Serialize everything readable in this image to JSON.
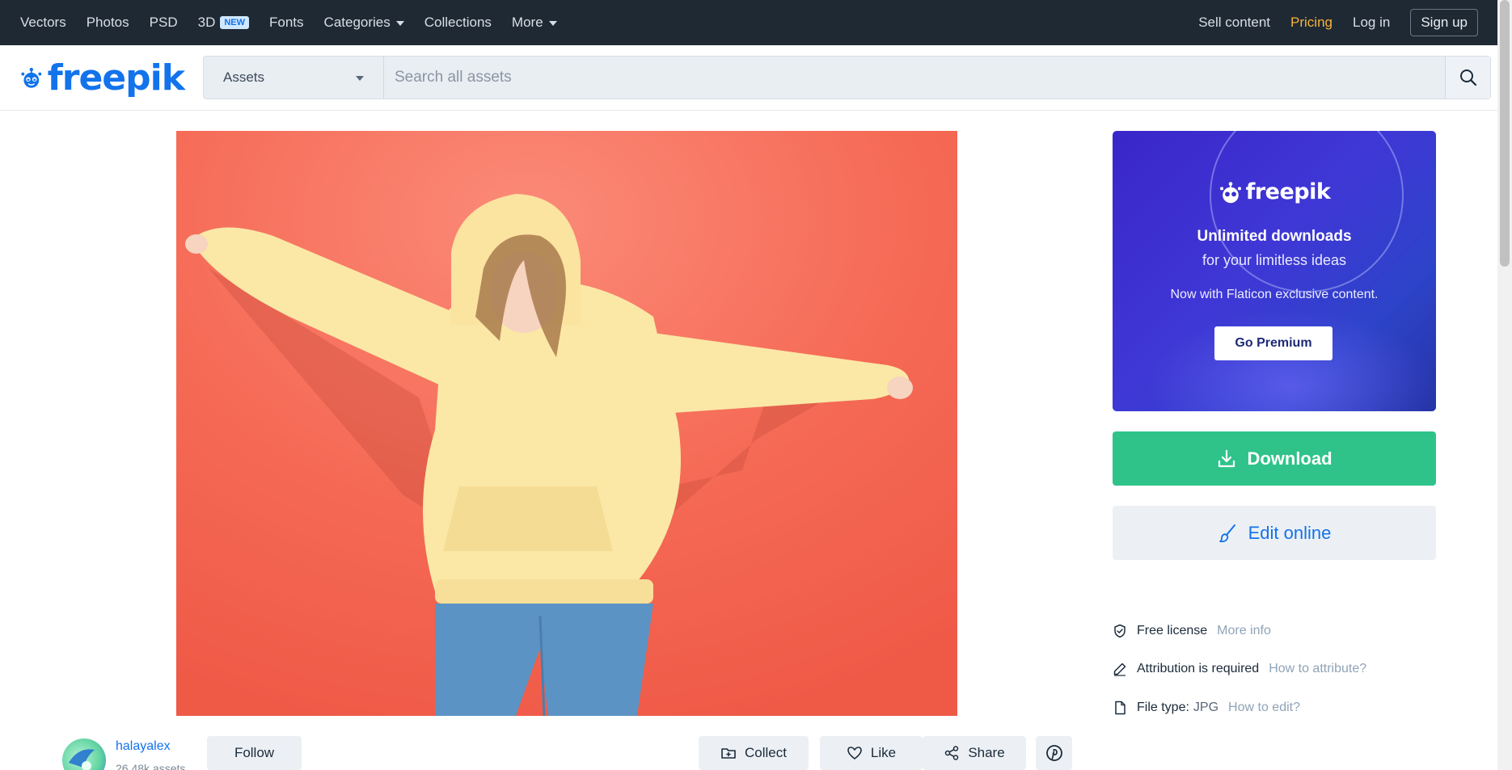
{
  "topnav": {
    "items": [
      {
        "label": "Vectors"
      },
      {
        "label": "Photos"
      },
      {
        "label": "PSD"
      },
      {
        "label": "3D",
        "badge": "NEW"
      },
      {
        "label": "Fonts"
      },
      {
        "label": "Categories"
      },
      {
        "label": "Collections"
      },
      {
        "label": "More"
      }
    ],
    "sell_label": "Sell content",
    "pricing_label": "Pricing",
    "login_label": "Log in",
    "signup_label": "Sign up"
  },
  "header": {
    "logo_text": "freepik",
    "search_scope": "Assets",
    "search_placeholder": "Search all assets"
  },
  "promo": {
    "logo_text": "freepik",
    "title": "Unlimited downloads",
    "subtitle": "for your limitless ideas",
    "description": "Now with Flaticon exclusive content.",
    "button_label": "Go Premium"
  },
  "actions": {
    "download_label": "Download",
    "edit_label": "Edit online"
  },
  "license": {
    "license_label": "Free license",
    "license_link": "More info",
    "attribution_label": "Attribution is required",
    "attribution_link": "How to attribute?",
    "filetype_label": "File type:",
    "filetype_value": "JPG",
    "filetype_link": "How to edit?"
  },
  "author": {
    "name": "halayalex",
    "assets_count": "26.48k assets",
    "follow_label": "Follow"
  },
  "bottom_actions": {
    "collect_label": "Collect",
    "like_label": "Like",
    "share_label": "Share"
  },
  "colors": {
    "topnav_bg": "#1f2933",
    "brand_blue": "#1273eb",
    "pricing_orange": "#f7b23b",
    "download_green": "#2fc38a",
    "photo_background": "#f3634f"
  }
}
